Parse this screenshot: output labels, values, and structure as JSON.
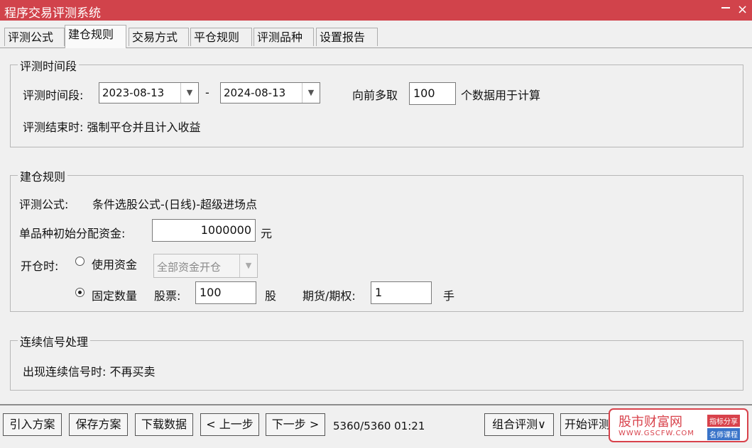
{
  "window": {
    "title": "程序交易评测系统"
  },
  "tabs": [
    "评测公式",
    "建仓规则",
    "交易方式",
    "平仓规则",
    "评测品种",
    "设置报告"
  ],
  "period": {
    "group_title": "评测时间段",
    "label": "评测时间段:",
    "start": "2023-08-13",
    "dash": "-",
    "end": "2024-08-13",
    "lookback_label": "向前多取",
    "lookback_value": "100",
    "lookback_suffix": "个数据用于计算",
    "end_rule": "评测结束时: 强制平仓并且计入收益"
  },
  "open_rules": {
    "group_title": "建仓规则",
    "formula_label": "评测公式:",
    "formula_value": "条件选股公式-(日线)-超级进场点",
    "capital_label": "单品种初始分配资金:",
    "capital_value": "1000000",
    "capital_unit": "元",
    "open_label": "开仓时:",
    "option_capital": "使用资金",
    "capital_mode": "全部资金开仓",
    "option_fixed": "固定数量",
    "selected_option": "固定数量",
    "stock_label": "股票:",
    "stock_value": "100",
    "stock_unit": "股",
    "futures_label": "期货/期权:",
    "futures_value": "1",
    "futures_unit": "手"
  },
  "signals": {
    "group_title": "连续信号处理",
    "rule": "出现连续信号时: 不再买卖"
  },
  "footer": {
    "import": "引入方案",
    "save": "保存方案",
    "download": "下载数据",
    "prev": "< 上一步",
    "next": "下一步 >",
    "status": "5360/5360  01:21",
    "combo_eval": "组合评测∨",
    "start_eval": "开始评测"
  },
  "watermark": {
    "name": "股市财富网",
    "url": "WWW.GSCFW.COM",
    "tag1": "指标分享",
    "tag2": "名师课程"
  },
  "colors": {
    "titlebar": "#d1434b",
    "watermark": "#d8424b"
  }
}
